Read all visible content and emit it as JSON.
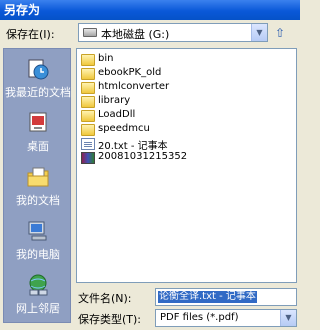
{
  "window": {
    "title": "另存为"
  },
  "save_in": {
    "label": "保存在(I):",
    "value": "本地磁盘 (G:)",
    "icon": "drive-icon"
  },
  "toolbar": {
    "buttons": [
      {
        "name": "back-icon",
        "glyph": "←"
      },
      {
        "name": "up-folder-icon",
        "glyph": "⇧"
      },
      {
        "name": "new-folder-icon",
        "glyph": "✱"
      },
      {
        "name": "view-menu-icon",
        "glyph": "▦"
      }
    ]
  },
  "places": [
    {
      "label": "我最近的文档",
      "icon": "recent-documents-icon"
    },
    {
      "label": "桌面",
      "icon": "desktop-icon"
    },
    {
      "label": "我的文档",
      "icon": "my-documents-icon"
    },
    {
      "label": "我的电脑",
      "icon": "my-computer-icon"
    },
    {
      "label": "网上邻居",
      "icon": "network-places-icon"
    }
  ],
  "files": [
    {
      "name": "bin",
      "type": "folder"
    },
    {
      "name": "ebookPK_old",
      "type": "folder"
    },
    {
      "name": "htmlconverter",
      "type": "folder"
    },
    {
      "name": "library",
      "type": "folder"
    },
    {
      "name": "LoadDll",
      "type": "folder"
    },
    {
      "name": "speedmcu",
      "type": "folder"
    },
    {
      "name": "20.txt - 记事本",
      "type": "text"
    },
    {
      "name": "20081031215352",
      "type": "archive"
    }
  ],
  "filename": {
    "label": "文件名(N):",
    "value": "论衡全译.txt - 记事本"
  },
  "filetype": {
    "label": "保存类型(T):",
    "value": "PDF files (*.pdf)"
  }
}
